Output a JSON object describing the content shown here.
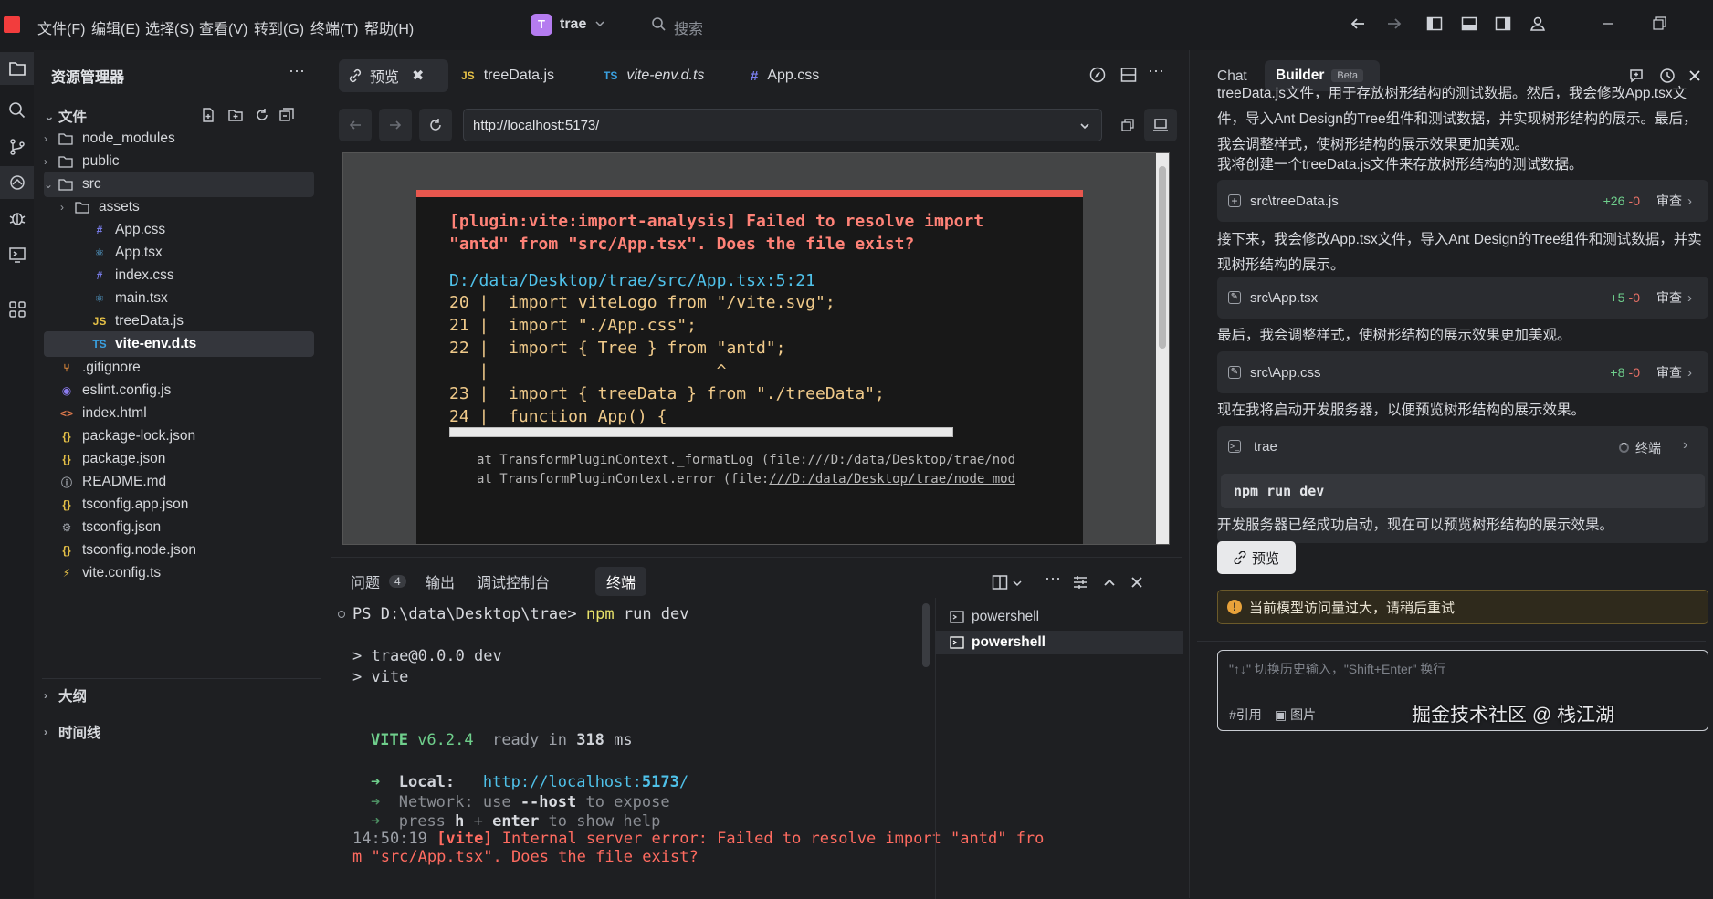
{
  "menu": [
    "文件(F)",
    "编辑(E)",
    "选择(S)",
    "查看(V)",
    "转到(G)",
    "终端(T)",
    "帮助(H)"
  ],
  "project": {
    "initial": "T",
    "name": "trae"
  },
  "search": {
    "placeholder": "搜索"
  },
  "explorer": {
    "title": "资源管理器",
    "section": "文件",
    "items": [
      {
        "label": "node_modules",
        "icon": "folder-icon",
        "chev": "›"
      },
      {
        "label": "public",
        "icon": "folder-icon",
        "chev": "›"
      },
      {
        "label": "src",
        "icon": "folder-open-icon",
        "chev": "⌄"
      },
      {
        "label": "assets",
        "icon": "folder-icon",
        "chev": "›"
      },
      {
        "label": "App.css",
        "icon": "css-icon"
      },
      {
        "label": "App.tsx",
        "icon": "react-icon"
      },
      {
        "label": "index.css",
        "icon": "css-icon"
      },
      {
        "label": "main.tsx",
        "icon": "react-icon"
      },
      {
        "label": "treeData.js",
        "icon": "js-icon"
      },
      {
        "label": "vite-env.d.ts",
        "icon": "ts-icon"
      },
      {
        "label": ".gitignore",
        "icon": "git-icon"
      },
      {
        "label": "eslint.config.js",
        "icon": "eslint-icon"
      },
      {
        "label": "index.html",
        "icon": "html-icon"
      },
      {
        "label": "package-lock.json",
        "icon": "json-icon"
      },
      {
        "label": "package.json",
        "icon": "json-icon"
      },
      {
        "label": "README.md",
        "icon": "info-icon"
      },
      {
        "label": "tsconfig.app.json",
        "icon": "json-icon"
      },
      {
        "label": "tsconfig.json",
        "icon": "gear-icon"
      },
      {
        "label": "tsconfig.node.json",
        "icon": "json-icon"
      },
      {
        "label": "vite.config.ts",
        "icon": "vite-icon"
      }
    ],
    "outline": "大纲",
    "timeline": "时间线"
  },
  "editor": {
    "tabs": [
      {
        "label": "预览",
        "icon": "preview-icon"
      },
      {
        "label": "treeData.js",
        "prefix": "JS"
      },
      {
        "label": "vite-env.d.ts",
        "prefix": "TS"
      },
      {
        "label": "App.css",
        "prefix": "#"
      }
    ],
    "url": "http://localhost:5173/",
    "error": {
      "line1": "[plugin:vite:import-analysis] Failed to resolve import",
      "line2": "\"antd\" from \"src/App.tsx\". Does the file exist?",
      "loc_prefix": "D:",
      "loc_link": "/data/Desktop/trae/src/App.tsx:5:21",
      "code": [
        {
          "n": "20",
          "text": "  import viteLogo from \"/vite.svg\";"
        },
        {
          "n": "21",
          "text": "  import \"./App.css\";"
        },
        {
          "n": "22",
          "text": "  import { Tree } from \"antd\";"
        },
        {
          "n": "  ",
          "text": "                       ^"
        },
        {
          "n": "23",
          "text": "  import { treeData } from \"./treeData\";"
        },
        {
          "n": "24",
          "text": "  function App() {"
        }
      ],
      "stack1_pre": "at TransformPluginContext._formatLog (file:",
      "stack1_link": "///D:/data/Desktop/trae/nod",
      "stack2_pre": "at TransformPluginContext.error (file:",
      "stack2_link": "///D:/data/Desktop/trae/node_mod"
    }
  },
  "terminal": {
    "tabs": [
      {
        "label": "问题",
        "badge": "4"
      },
      {
        "label": "输出"
      },
      {
        "label": "调试控制台"
      },
      {
        "label": "终端"
      }
    ],
    "prompt": "PS D:\\data\\Desktop\\trae>",
    "cmd": "npm",
    "cmd_rest": " run dev",
    "l_trae": "> trae@0.0.0 dev",
    "l_vite": "> vite",
    "vite_name": "VITE",
    "vite_ver": " v6.2.4",
    "ready": "  ready in ",
    "ms_num": "318",
    "ms": " ms",
    "local_label": "Local:",
    "local_url": "http://localhost:",
    "local_port": "5173",
    "local_slash": "/",
    "network_label": "Network:",
    "network_rest": " use ",
    "network_host": "--host",
    "network_tail": " to expose",
    "help_a": "press ",
    "help_h": "h",
    "help_plus": " + ",
    "help_enter": "enter",
    "help_tail": " to show help",
    "err_time": "14:50:19 ",
    "err_tag": "[vite]",
    "err_msg": " Internal server error: Failed to resolve import \"antd\" fro",
    "err_msg2": "m \"src/App.tsx\". Does the file exist?",
    "shells": [
      "powershell",
      "powershell"
    ]
  },
  "chat": {
    "tabs": {
      "chat": "Chat",
      "builder": "Builder",
      "beta": "Beta"
    },
    "p1": "treeData.js文件，用于存放树形结构的测试数据。然后，我会修改App.tsx文件，导入Ant Design的Tree组件和测试数据，并实现树形结构的展示。最后，我会调整样式，使树形结构的展示效果更加美观。",
    "p2": "我将创建一个treeData.js文件来存放树形结构的测试数据。",
    "card1": {
      "file": "src\\treeData.js",
      "add": "+26",
      "del": "-0",
      "action": "审查"
    },
    "p3": "接下来，我会修改App.tsx文件，导入Ant Design的Tree组件和测试数据，并实现树形结构的展示。",
    "card2": {
      "file": "src\\App.tsx",
      "add": "+5",
      "del": "-0",
      "action": "审查"
    },
    "p4": "最后，我会调整样式，使树形结构的展示效果更加美观。",
    "card3": {
      "file": "src\\App.css",
      "add": "+8",
      "del": "-0",
      "action": "审查"
    },
    "p5": "现在我将启动开发服务器，以便预览树形结构的展示效果。",
    "term_card": {
      "name": "trae",
      "status": "终端",
      "cmd": "npm run dev"
    },
    "p6": "开发服务器已经成功启动，现在可以预览树形结构的展示效果。",
    "preview_btn": "预览",
    "warning": "当前模型访问量过大，请稍后重试",
    "input_placeholder": "\"↑↓\" 切换历史输入，\"Shift+Enter\" 换行",
    "ref": "#引用",
    "image": "图片",
    "watermark": "掘金技术社区 @ 栈江湖"
  },
  "colors": {
    "accent": "#f23d3d",
    "link": "#4fc1e9",
    "error": "#ff6b60",
    "green": "#6fcf8c",
    "warning_bg": "#2f2a1c"
  }
}
